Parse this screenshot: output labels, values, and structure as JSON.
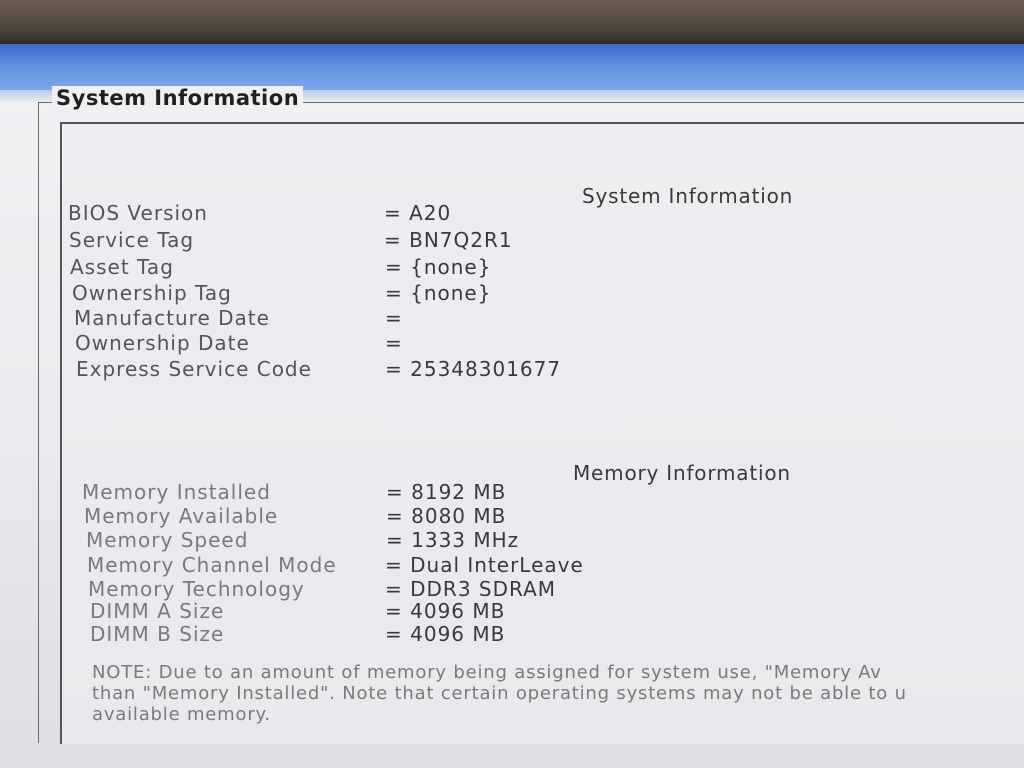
{
  "group_title": "System Information",
  "system_section": {
    "title": "System Information",
    "rows": [
      {
        "label": "BIOS Version",
        "value": "= A20"
      },
      {
        "label": "Service Tag",
        "value": "= BN7Q2R1"
      },
      {
        "label": "Asset Tag",
        "value": "= {none}"
      },
      {
        "label": "Ownership Tag",
        "value": "= {none}"
      },
      {
        "label": "Manufacture Date",
        "value": "="
      },
      {
        "label": "Ownership Date",
        "value": "="
      },
      {
        "label": "Express Service Code",
        "value": "= 25348301677"
      }
    ]
  },
  "memory_section": {
    "title": "Memory Information",
    "rows": [
      {
        "label": "Memory Installed",
        "value": "= 8192 MB"
      },
      {
        "label": "Memory Available",
        "value": "= 8080 MB"
      },
      {
        "label": "Memory Speed",
        "value": "= 1333 MHz"
      },
      {
        "label": "Memory Channel Mode",
        "value": "= Dual InterLeave"
      },
      {
        "label": "Memory Technology",
        "value": "= DDR3 SDRAM"
      },
      {
        "label": "DIMM A Size",
        "value": "= 4096 MB"
      },
      {
        "label": "DIMM B Size",
        "value": "= 4096 MB"
      }
    ]
  },
  "note": {
    "line1": "NOTE: Due to an amount of memory being assigned for system use, \"Memory Av",
    "line2": "than \"Memory Installed\". Note that certain operating systems may not be able to u",
    "line3": "available memory."
  }
}
